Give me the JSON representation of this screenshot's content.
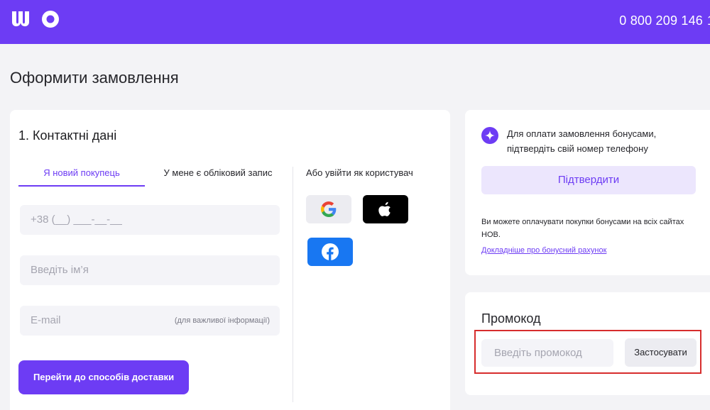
{
  "header": {
    "logo_text": "WO",
    "phone": "0 800 209 146",
    "phone_extra": "1"
  },
  "page": {
    "title": "Оформити замовлення"
  },
  "contact": {
    "title": "1. Контактні дані",
    "tabs": [
      {
        "label": "Я новий покупець",
        "active": true
      },
      {
        "label": "У мене є обліковий запис",
        "active": false
      }
    ],
    "phone_placeholder": "+38  (__) ___-__-__",
    "name_placeholder": "Введіть ім’я",
    "email_placeholder": "E-mail",
    "email_hint": "(для важливої інформації)",
    "submit_label": "Перейти до способів доставки"
  },
  "social": {
    "title": "Або увійти як користувач",
    "buttons": [
      {
        "name": "google",
        "icon": "google-icon"
      },
      {
        "name": "apple",
        "icon": "apple-icon"
      },
      {
        "name": "facebook",
        "icon": "facebook-icon"
      }
    ]
  },
  "bonus": {
    "icon": "sparkle-icon",
    "message": "Для оплати замовлення бонусами, підтвердіть свій номер телефону",
    "confirm_label": "Підтвердити",
    "info": "Ви можете оплачувати покупки бонусами на всіх сайтах НОВ.",
    "link": "Докладніше про бонусний рахунок"
  },
  "promo": {
    "title": "Промокод",
    "input_placeholder": "Введіть промокод",
    "apply_label": "Застосувати"
  },
  "colors": {
    "brand": "#6d3cf4",
    "highlight_frame": "#d72d2d"
  }
}
